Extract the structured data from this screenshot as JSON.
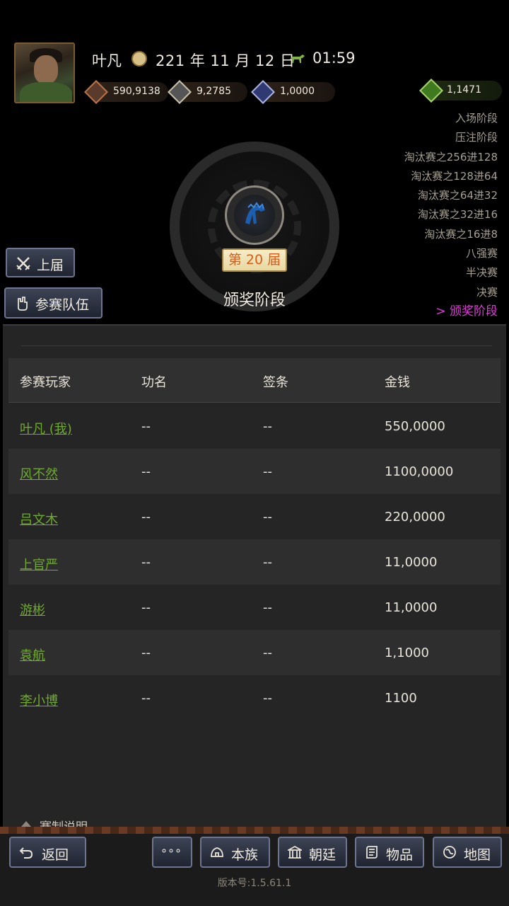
{
  "header": {
    "player_name": "叶凡",
    "date": "221 年 11 月 12 日",
    "time": "01:59",
    "resources": [
      {
        "icon": "coins-icon",
        "value": "590,9138"
      },
      {
        "icon": "grain-icon",
        "value": "9,2785"
      },
      {
        "icon": "soldier-icon",
        "value": "1,0000"
      }
    ],
    "money_bag": {
      "icon": "money-bag-icon",
      "value": "1,1471"
    }
  },
  "stages": {
    "items": [
      "入场阶段",
      "压注阶段",
      "淘汰赛之256进128",
      "淘汰赛之128进64",
      "淘汰赛之64进32",
      "淘汰赛之32进16",
      "淘汰赛之16进8",
      "八强赛",
      "半决赛",
      "决赛"
    ],
    "current": "> 颁奖阶段"
  },
  "tournament": {
    "session": "第 20 届",
    "stage_title": "颁奖阶段"
  },
  "side_buttons": {
    "previous": "上届",
    "teams": "参赛队伍"
  },
  "table": {
    "headers": [
      "参赛玩家",
      "功名",
      "签条",
      "金钱"
    ],
    "rows": [
      {
        "name": "叶凡 (我)",
        "merit": "--",
        "tag": "--",
        "money": "550,0000"
      },
      {
        "name": "风不然",
        "merit": "--",
        "tag": "--",
        "money": "1100,0000"
      },
      {
        "name": "吕文木",
        "merit": "--",
        "tag": "--",
        "money": "220,0000"
      },
      {
        "name": "上官严",
        "merit": "--",
        "tag": "--",
        "money": "11,0000"
      },
      {
        "name": "游彬",
        "merit": "--",
        "tag": "--",
        "money": "11,0000"
      },
      {
        "name": "袁航",
        "merit": "--",
        "tag": "--",
        "money": "1,1000"
      },
      {
        "name": "李小博",
        "merit": "--",
        "tag": "--",
        "money": "1100"
      }
    ]
  },
  "rules_label": "赛制说明",
  "nav": {
    "back": "返回",
    "more": "∘∘∘",
    "clan": "本族",
    "court": "朝廷",
    "items": "物品",
    "map": "地图"
  },
  "version": "版本号:1.5.61.1",
  "colors": {
    "current_stage": "#e03bd9",
    "player_link": "#6faa2f",
    "session_text": "#e05a16"
  }
}
